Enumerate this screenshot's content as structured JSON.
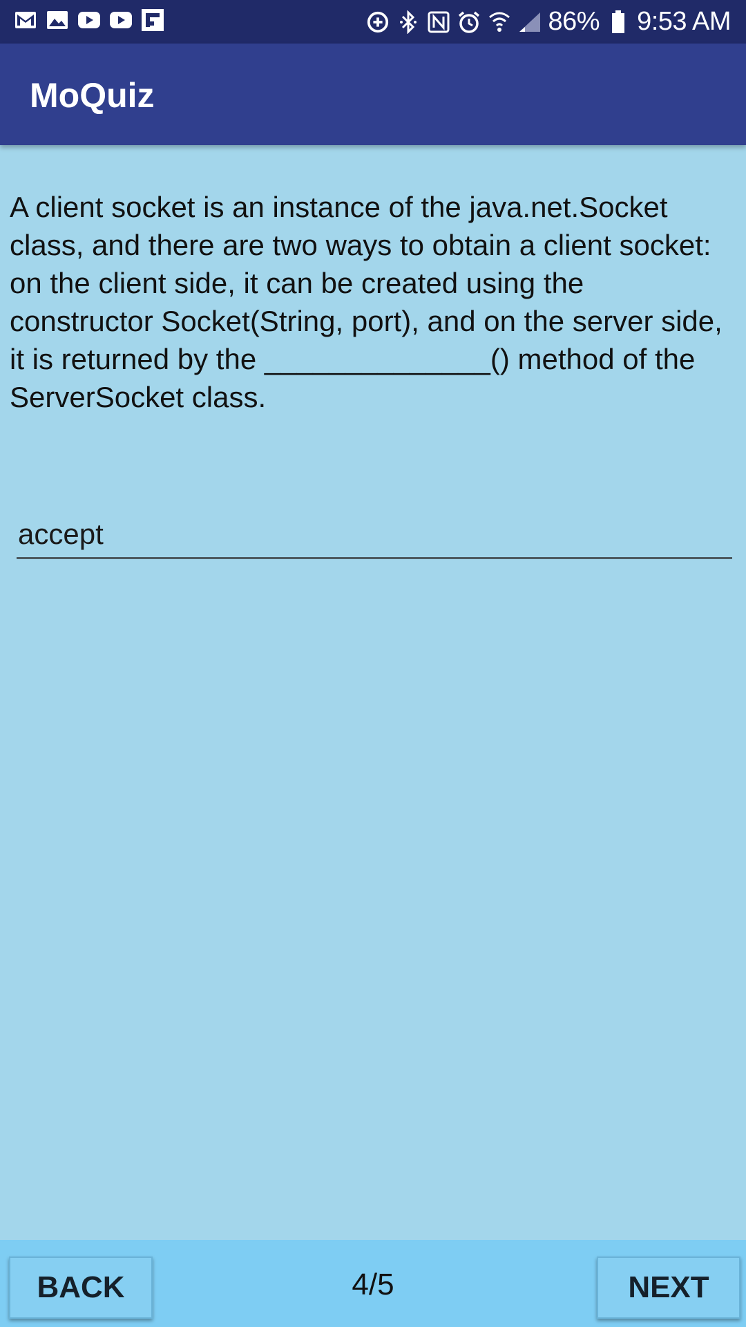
{
  "status_bar": {
    "notification_icons": [
      "gmail-icon",
      "gallery-icon",
      "youtube-icon",
      "youtube-icon",
      "flipboard-icon"
    ],
    "system_icons": [
      "data-saver-icon",
      "bluetooth-icon",
      "nfc-icon",
      "alarm-icon",
      "wifi-icon",
      "cell-signal-icon"
    ],
    "battery_percent": "86%",
    "time": "9:53 AM"
  },
  "app_bar": {
    "title": "MoQuiz"
  },
  "question": {
    "text": "A client socket is an instance of the java.net.Socket class, and there are two ways to obtain a client socket: on the client side, it can be created using the constructor Socket(String, port), and on the server side, it is returned by the ______________() method of the ServerSocket class."
  },
  "answer": {
    "value": "accept"
  },
  "navigation": {
    "back_label": "BACK",
    "progress": "4/5",
    "next_label": "NEXT"
  },
  "colors": {
    "status_bar": "#202a68",
    "app_bar": "#303f8e",
    "content_background": "#a3d6eb",
    "bottom_bar": "#7ecdf3",
    "button": "#86cff2"
  }
}
